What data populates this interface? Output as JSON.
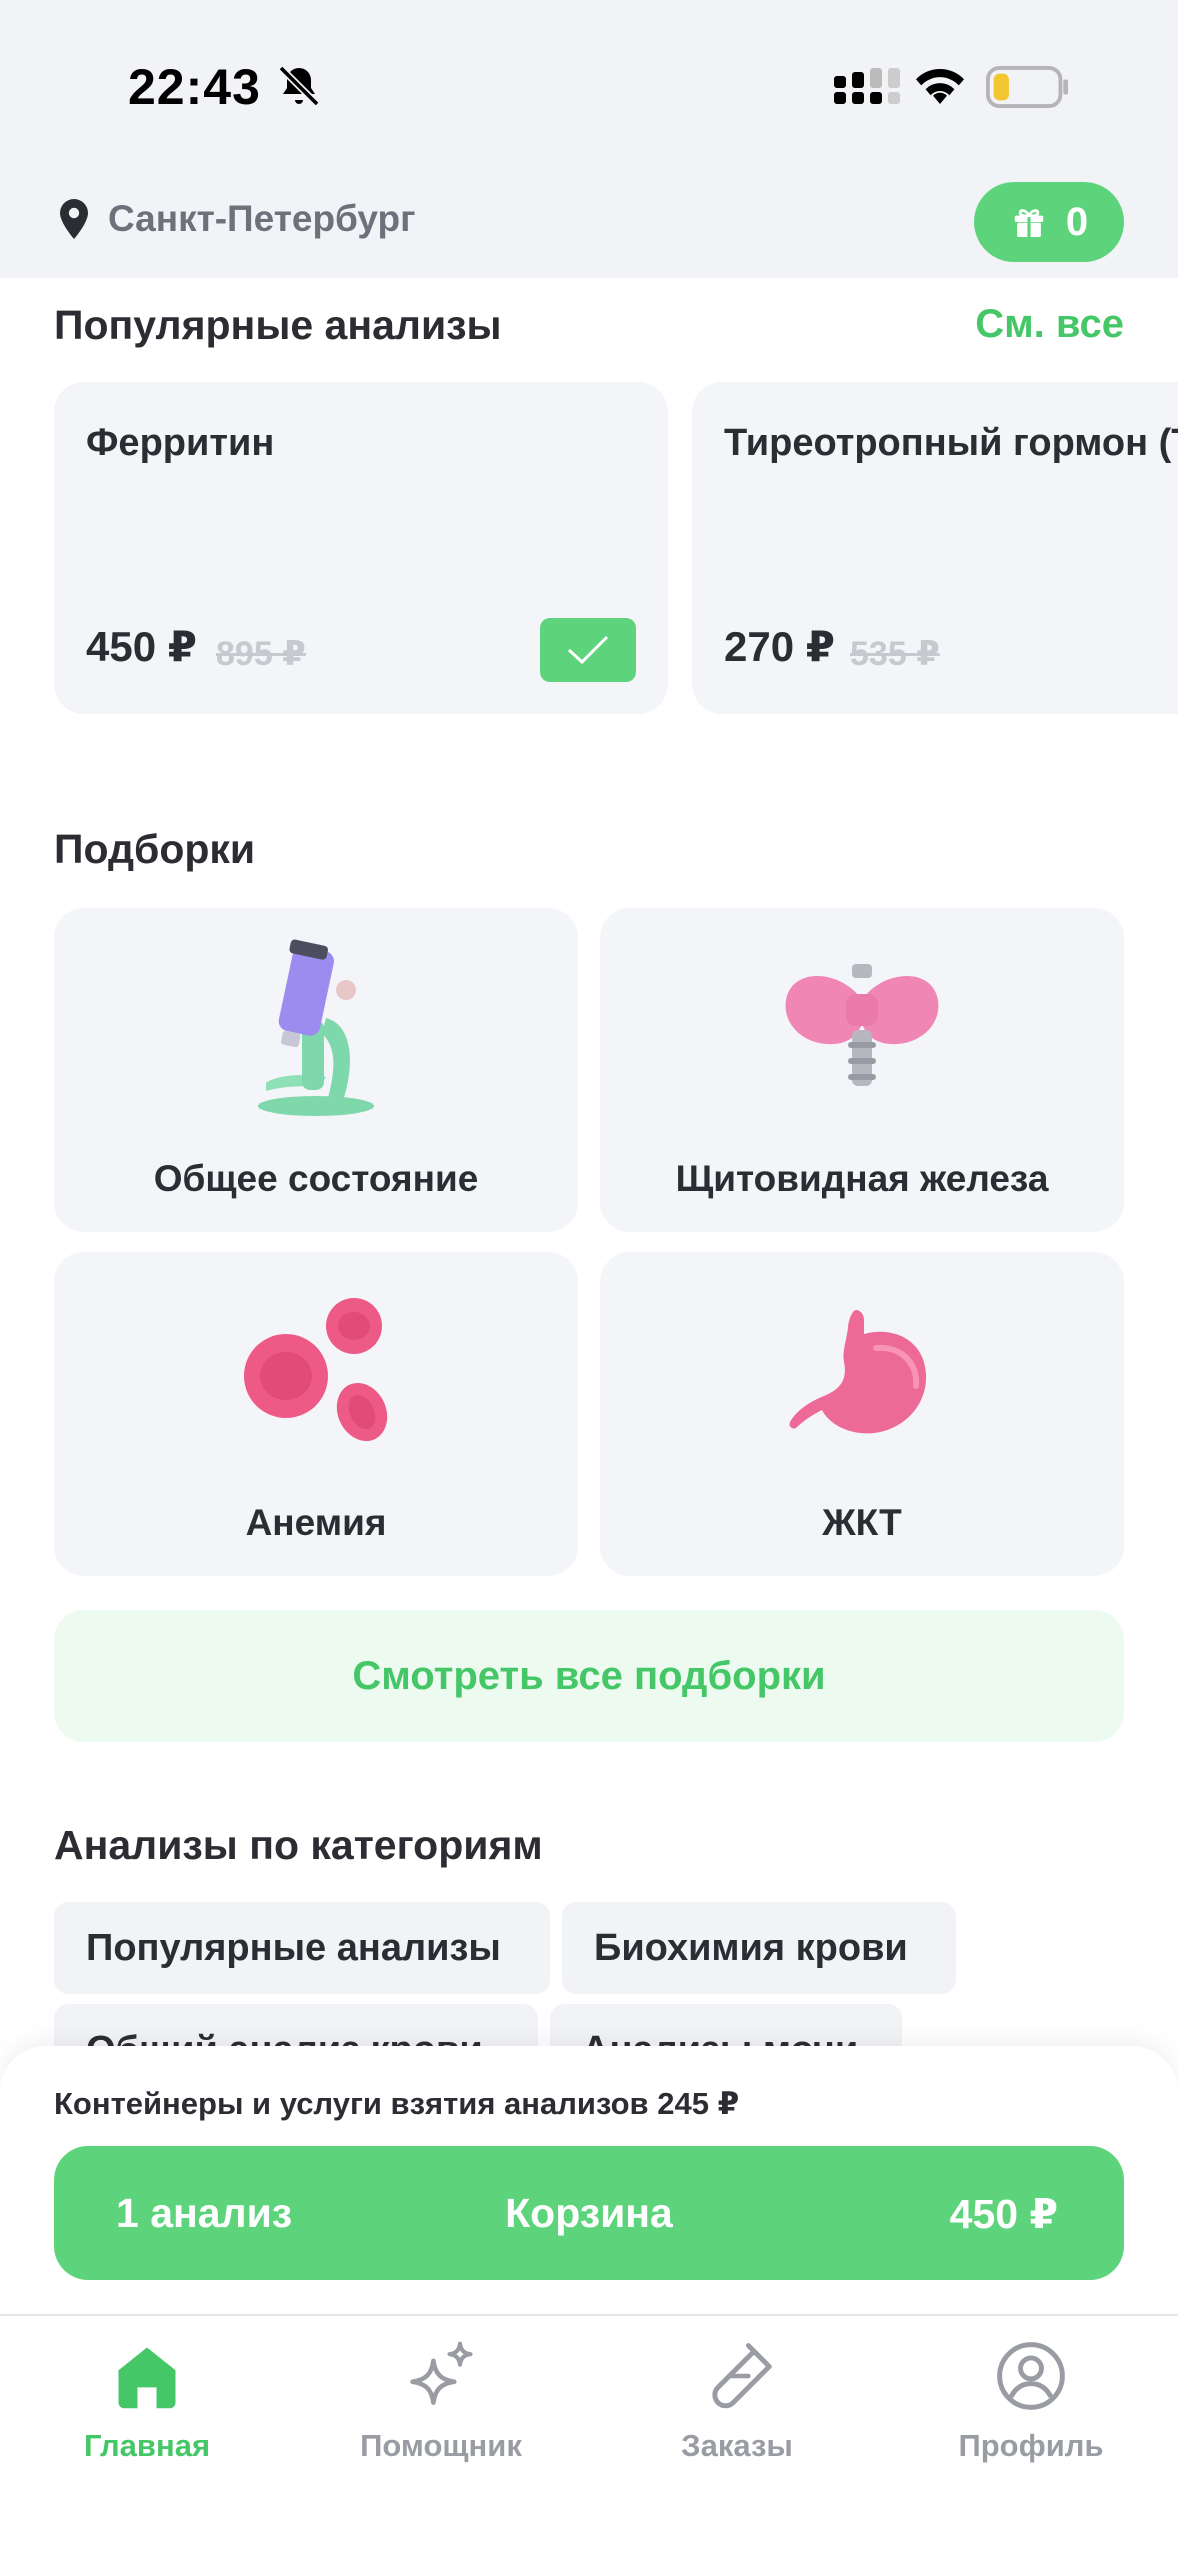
{
  "status_bar": {
    "time": "22:43"
  },
  "header": {
    "city": "Санкт-Петербург",
    "gift_count": "0"
  },
  "popular": {
    "title": "Популярные анализы",
    "see_all": "См. все",
    "items": [
      {
        "name": "Ферритин",
        "price": "450 ₽",
        "old_price": "895 ₽",
        "in_cart": true
      },
      {
        "name": "Тиреотропный гормон (ТТГ)",
        "price": "270 ₽",
        "old_price": "535 ₽",
        "in_cart": false
      }
    ]
  },
  "collections": {
    "title": "Подборки",
    "items": [
      {
        "label": "Общее состояние",
        "icon": "microscope-icon"
      },
      {
        "label": "Щитовидная железа",
        "icon": "thyroid-icon"
      },
      {
        "label": "Анемия",
        "icon": "blood-cells-icon"
      },
      {
        "label": "ЖКТ",
        "icon": "stomach-icon"
      }
    ],
    "see_all_button": "Смотреть все подборки"
  },
  "categories": {
    "title": "Анализы по категориям",
    "chips": [
      "Популярные анализы",
      "Биохимия крови",
      "Общий анализ крови",
      "Анализы мочи"
    ]
  },
  "cart": {
    "fee_text": "Контейнеры и услуги взятия анализов 245 ₽",
    "count": "1 анализ",
    "label": "Корзина",
    "total": "450 ₽"
  },
  "tabbar": {
    "tabs": [
      {
        "label": "Главная",
        "icon": "home-icon",
        "active": true
      },
      {
        "label": "Помощник",
        "icon": "sparkle-icon",
        "active": false
      },
      {
        "label": "Заказы",
        "icon": "test-tube-icon",
        "active": false
      },
      {
        "label": "Профиль",
        "icon": "profile-icon",
        "active": false
      }
    ]
  },
  "colors": {
    "accent": "#5dd47b",
    "accent_text": "#45c768",
    "card_bg": "#f4f5f9",
    "header_bg": "#f2f3f7"
  }
}
